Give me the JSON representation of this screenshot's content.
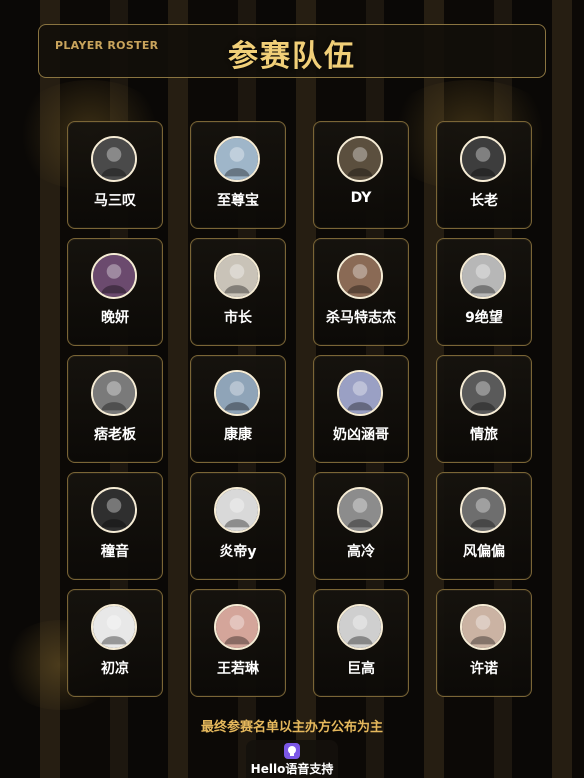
{
  "header": {
    "subtitle_en": "PLAYER ROSTER",
    "title_cn": "参赛队伍"
  },
  "players": [
    {
      "name": "马三叹",
      "avatar": "avatar-icon",
      "color": "#4a4a4a"
    },
    {
      "name": "至尊宝",
      "avatar": "avatar-icon",
      "color": "#9fb6c9"
    },
    {
      "name": "DY",
      "avatar": "avatar-icon",
      "color": "#5b4f3e"
    },
    {
      "name": "长老",
      "avatar": "avatar-icon",
      "color": "#3d3d3d"
    },
    {
      "name": "晚妍",
      "avatar": "avatar-icon",
      "color": "#6b4a6e"
    },
    {
      "name": "市长",
      "avatar": "avatar-icon",
      "color": "#c9c3b8"
    },
    {
      "name": "杀马特志杰",
      "avatar": "avatar-icon",
      "color": "#8a6a55"
    },
    {
      "name": "9绝望",
      "avatar": "avatar-icon",
      "color": "#b7b7b7"
    },
    {
      "name": "痞老板",
      "avatar": "avatar-icon",
      "color": "#7a7a7a"
    },
    {
      "name": "康康",
      "avatar": "avatar-icon",
      "color": "#8fa4b8"
    },
    {
      "name": "奶凶涵哥",
      "avatar": "avatar-icon",
      "color": "#9aa0c4"
    },
    {
      "name": "情旅",
      "avatar": "avatar-icon",
      "color": "#5a5a5a"
    },
    {
      "name": "穜音",
      "avatar": "avatar-icon",
      "color": "#2f2f2f"
    },
    {
      "name": "炎帝y",
      "avatar": "avatar-icon",
      "color": "#d9d9d9"
    },
    {
      "name": "高冷",
      "avatar": "avatar-icon",
      "color": "#8c8c8c"
    },
    {
      "name": "风偏偏",
      "avatar": "avatar-icon",
      "color": "#6e6e6e"
    },
    {
      "name": "初凉",
      "avatar": "avatar-icon",
      "color": "#e8e8e8"
    },
    {
      "name": "王若琳",
      "avatar": "avatar-icon",
      "color": "#d4a59a"
    },
    {
      "name": "巨高",
      "avatar": "avatar-icon",
      "color": "#cfcfcf"
    },
    {
      "name": "许诺",
      "avatar": "avatar-icon",
      "color": "#cbb3a3"
    }
  ],
  "footer": {
    "note": "最终参赛名单以主办方公布为主",
    "support_label": "Hello语音支持"
  },
  "colors": {
    "accent_gold": "#f1cf78",
    "border_gold": "#7a6536",
    "brand_purple": "#7b57e6"
  }
}
